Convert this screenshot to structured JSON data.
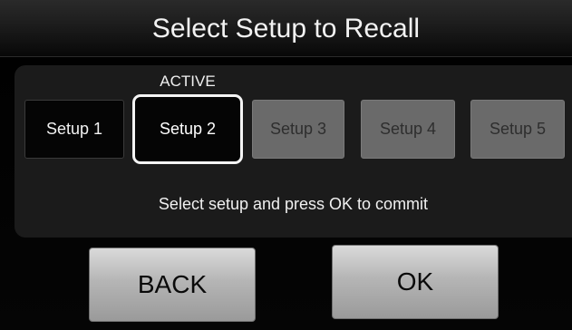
{
  "header": {
    "title": "Select Setup to Recall"
  },
  "setups": {
    "active_label": "ACTIVE",
    "items": [
      {
        "label": "Setup 1",
        "state": "available"
      },
      {
        "label": "Setup 2",
        "state": "active"
      },
      {
        "label": "Setup 3",
        "state": "disabled"
      },
      {
        "label": "Setup 4",
        "state": "disabled"
      },
      {
        "label": "Setup 5",
        "state": "disabled"
      }
    ]
  },
  "instruction": "Select setup and press OK to commit",
  "actions": {
    "back_label": "BACK",
    "ok_label": "OK"
  },
  "colors": {
    "background": "#050505",
    "panel": "#1b1b1b",
    "active_border": "#f4f4f4",
    "disabled_button": "#6a6a6a",
    "action_button": "#c4c4c4"
  }
}
